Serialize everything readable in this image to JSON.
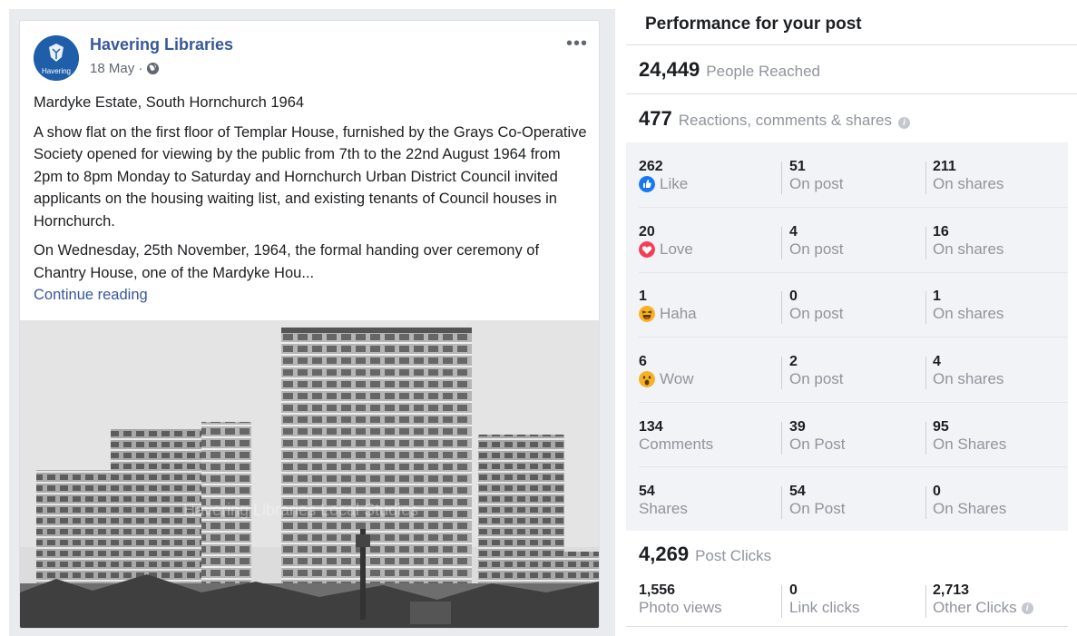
{
  "post": {
    "page_name": "Havering Libraries",
    "avatar_text": "Havering",
    "date": "18 May · ",
    "more": "•••",
    "title_line": "Mardyke Estate, South Hornchurch 1964",
    "paragraph1": "A show flat on the first floor of Templar House, furnished by the Grays Co-Operative Society opened for viewing by the public from 7th to the 22nd August 1964 from 2pm to 8pm Monday to Saturday and Hornchurch Urban District Council invited applicants on the housing waiting list, and existing tenants of Council houses in Hornchurch.",
    "paragraph2": "On Wednesday, 25th November, 1964, the formal handing over ceremony of Chantry House, one of the Mardyke Hou...",
    "continue_reading": "Continue reading",
    "photo_watermark": "Havering Libraries Local Studies"
  },
  "performance": {
    "title": "Performance for your post",
    "people_reached": {
      "value": "24,449",
      "label": "People Reached"
    },
    "engagement": {
      "value": "477",
      "label": "Reactions, comments & shares"
    },
    "rows": [
      {
        "total": "262",
        "total_label": "Like",
        "icon": "like-icon",
        "post": "51",
        "post_label": "On post",
        "shares": "211",
        "shares_label": "On shares"
      },
      {
        "total": "20",
        "total_label": "Love",
        "icon": "love-icon",
        "post": "4",
        "post_label": "On post",
        "shares": "16",
        "shares_label": "On shares"
      },
      {
        "total": "1",
        "total_label": "Haha",
        "icon": "haha-icon",
        "post": "0",
        "post_label": "On post",
        "shares": "1",
        "shares_label": "On shares"
      },
      {
        "total": "6",
        "total_label": "Wow",
        "icon": "wow-icon",
        "post": "2",
        "post_label": "On post",
        "shares": "4",
        "shares_label": "On shares"
      },
      {
        "total": "134",
        "total_label": "Comments",
        "icon": "",
        "post": "39",
        "post_label": "On Post",
        "shares": "95",
        "shares_label": "On Shares"
      },
      {
        "total": "54",
        "total_label": "Shares",
        "icon": "",
        "post": "54",
        "post_label": "On Post",
        "shares": "0",
        "shares_label": "On Shares"
      }
    ],
    "post_clicks": {
      "value": "4,269",
      "label": "Post Clicks"
    },
    "clicks": {
      "photo_views": "1,556",
      "photo_views_label": "Photo views",
      "link_clicks": "0",
      "link_clicks_label": "Link clicks",
      "other_clicks": "2,713",
      "other_clicks_label": "Other Clicks"
    },
    "info_glyph": "i"
  },
  "colors": {
    "link": "#385898",
    "muted": "#90949c",
    "like": "#1877f2",
    "love": "#f33e58",
    "haha": "#f7b125"
  }
}
